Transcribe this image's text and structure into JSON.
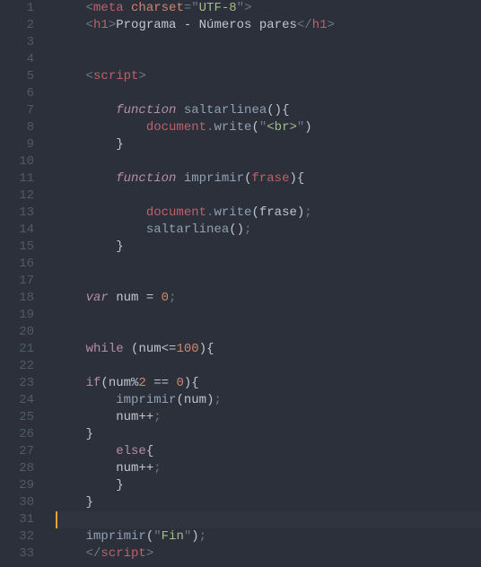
{
  "chart_data": null,
  "code": {
    "lines": [
      {
        "n": 1,
        "indent": 1,
        "tokens": [
          [
            "punc",
            "<"
          ],
          [
            "tag",
            "meta"
          ],
          [
            "text",
            " "
          ],
          [
            "attr",
            "charset"
          ],
          [
            "punc",
            "="
          ],
          [
            "punc",
            "\""
          ],
          [
            "str",
            "UTF-8"
          ],
          [
            "punc",
            "\""
          ],
          [
            "punc",
            ">"
          ]
        ]
      },
      {
        "n": 2,
        "indent": 1,
        "tokens": [
          [
            "punc",
            "<"
          ],
          [
            "tag",
            "h1"
          ],
          [
            "punc",
            ">"
          ],
          [
            "text",
            "Programa - Números pares"
          ],
          [
            "punc",
            "</"
          ],
          [
            "tag",
            "h1"
          ],
          [
            "punc",
            ">"
          ]
        ]
      },
      {
        "n": 3,
        "indent": 0,
        "tokens": []
      },
      {
        "n": 4,
        "indent": 0,
        "tokens": []
      },
      {
        "n": 5,
        "indent": 1,
        "tokens": [
          [
            "punc",
            "<"
          ],
          [
            "tag",
            "script"
          ],
          [
            "punc",
            ">"
          ]
        ]
      },
      {
        "n": 6,
        "indent": 0,
        "tokens": []
      },
      {
        "n": 7,
        "indent": 2,
        "tokens": [
          [
            "kw",
            "function"
          ],
          [
            "text",
            " "
          ],
          [
            "fn",
            "saltarlinea"
          ],
          [
            "bracket",
            "()"
          ],
          [
            "bracket",
            "{"
          ]
        ]
      },
      {
        "n": 8,
        "indent": 3,
        "tokens": [
          [
            "obj",
            "document"
          ],
          [
            "punc",
            "."
          ],
          [
            "fn",
            "write"
          ],
          [
            "bracket",
            "("
          ],
          [
            "punc",
            "\""
          ],
          [
            "str",
            "<br>"
          ],
          [
            "punc",
            "\""
          ],
          [
            "bracket",
            ")"
          ]
        ]
      },
      {
        "n": 9,
        "indent": 2,
        "tokens": [
          [
            "bracket",
            "}"
          ]
        ]
      },
      {
        "n": 10,
        "indent": 0,
        "tokens": []
      },
      {
        "n": 11,
        "indent": 2,
        "tokens": [
          [
            "kw",
            "function"
          ],
          [
            "text",
            " "
          ],
          [
            "fn",
            "imprimir"
          ],
          [
            "bracket",
            "("
          ],
          [
            "var",
            "frase"
          ],
          [
            "bracket",
            ")"
          ],
          [
            "bracket",
            "{"
          ]
        ]
      },
      {
        "n": 12,
        "indent": 0,
        "tokens": []
      },
      {
        "n": 13,
        "indent": 3,
        "tokens": [
          [
            "obj",
            "document"
          ],
          [
            "punc",
            "."
          ],
          [
            "fn",
            "write"
          ],
          [
            "bracket",
            "("
          ],
          [
            "text",
            "frase"
          ],
          [
            "bracket",
            ")"
          ],
          [
            "punc",
            ";"
          ]
        ]
      },
      {
        "n": 14,
        "indent": 3,
        "tokens": [
          [
            "fn",
            "saltarlinea"
          ],
          [
            "bracket",
            "()"
          ],
          [
            "punc",
            ";"
          ]
        ]
      },
      {
        "n": 15,
        "indent": 2,
        "tokens": [
          [
            "bracket",
            "}"
          ]
        ]
      },
      {
        "n": 16,
        "indent": 0,
        "tokens": []
      },
      {
        "n": 17,
        "indent": 0,
        "tokens": []
      },
      {
        "n": 18,
        "indent": 1,
        "tokens": [
          [
            "kw",
            "var"
          ],
          [
            "text",
            " "
          ],
          [
            "text",
            "num"
          ],
          [
            "text",
            " "
          ],
          [
            "op",
            "="
          ],
          [
            "text",
            " "
          ],
          [
            "num",
            "0"
          ],
          [
            "punc",
            ";"
          ]
        ]
      },
      {
        "n": 19,
        "indent": 0,
        "tokens": []
      },
      {
        "n": 20,
        "indent": 0,
        "tokens": []
      },
      {
        "n": 21,
        "indent": 1,
        "tokens": [
          [
            "kw2",
            "while"
          ],
          [
            "text",
            " "
          ],
          [
            "bracket",
            "("
          ],
          [
            "text",
            "num"
          ],
          [
            "op",
            "<="
          ],
          [
            "num",
            "100"
          ],
          [
            "bracket",
            ")"
          ],
          [
            "bracket",
            "{"
          ]
        ]
      },
      {
        "n": 22,
        "indent": 0,
        "tokens": []
      },
      {
        "n": 23,
        "indent": 1,
        "tokens": [
          [
            "kw2",
            "if"
          ],
          [
            "bracket",
            "("
          ],
          [
            "text",
            "num"
          ],
          [
            "op",
            "%"
          ],
          [
            "num",
            "2"
          ],
          [
            "text",
            " "
          ],
          [
            "op",
            "=="
          ],
          [
            "text",
            " "
          ],
          [
            "num",
            "0"
          ],
          [
            "bracket",
            ")"
          ],
          [
            "bracket",
            "{"
          ]
        ]
      },
      {
        "n": 24,
        "indent": 2,
        "tokens": [
          [
            "fn",
            "imprimir"
          ],
          [
            "bracket",
            "("
          ],
          [
            "text",
            "num"
          ],
          [
            "bracket",
            ")"
          ],
          [
            "punc",
            ";"
          ]
        ]
      },
      {
        "n": 25,
        "indent": 2,
        "tokens": [
          [
            "text",
            "num"
          ],
          [
            "op",
            "++"
          ],
          [
            "punc",
            ";"
          ]
        ]
      },
      {
        "n": 26,
        "indent": 1,
        "tokens": [
          [
            "bracket",
            "}"
          ]
        ]
      },
      {
        "n": 27,
        "indent": 2,
        "tokens": [
          [
            "kw2",
            "else"
          ],
          [
            "bracket",
            "{"
          ]
        ]
      },
      {
        "n": 28,
        "indent": 2,
        "tokens": [
          [
            "text",
            "num"
          ],
          [
            "op",
            "++"
          ],
          [
            "punc",
            ";"
          ]
        ]
      },
      {
        "n": 29,
        "indent": 2,
        "tokens": [
          [
            "bracket",
            "}"
          ]
        ]
      },
      {
        "n": 30,
        "indent": 1,
        "tokens": [
          [
            "bracket",
            "}"
          ]
        ]
      },
      {
        "n": 31,
        "indent": 1,
        "tokens": [],
        "active": true
      },
      {
        "n": 32,
        "indent": 1,
        "tokens": [
          [
            "fn",
            "imprimir"
          ],
          [
            "bracket",
            "("
          ],
          [
            "punc",
            "\""
          ],
          [
            "str",
            "Fin"
          ],
          [
            "punc",
            "\""
          ],
          [
            "bracket",
            ")"
          ],
          [
            "punc",
            ";"
          ]
        ]
      },
      {
        "n": 33,
        "indent": 1,
        "tokens": [
          [
            "punc",
            "</"
          ],
          [
            "tag",
            "script"
          ],
          [
            "punc",
            ">"
          ]
        ]
      }
    ]
  }
}
